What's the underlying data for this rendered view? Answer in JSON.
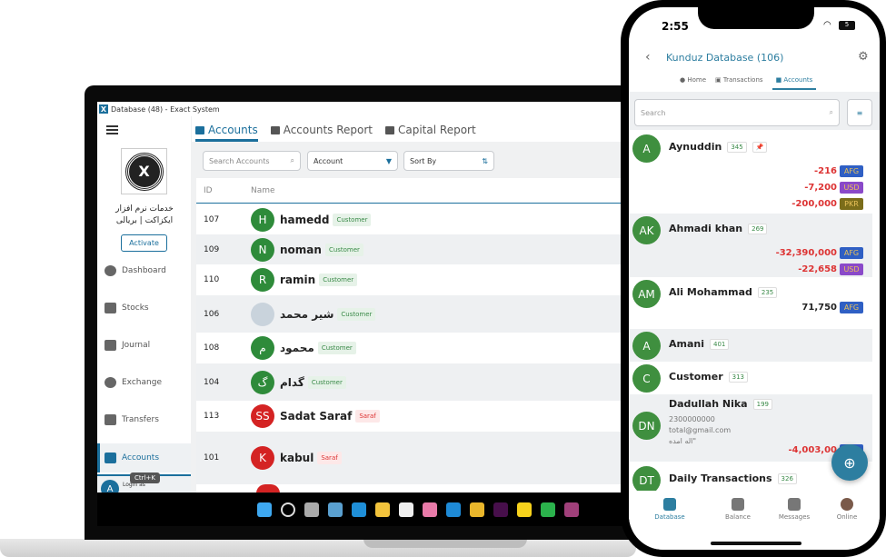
{
  "desktop": {
    "window_title": "Database (48) - Exact System",
    "company_name": "خدمات نرم افزار ایکزاکت | بریالی",
    "activate_label": "Activate",
    "sidebar": [
      {
        "label": "Dashboard"
      },
      {
        "label": "Stocks"
      },
      {
        "label": "Journal"
      },
      {
        "label": "Exchange"
      },
      {
        "label": "Transfers"
      },
      {
        "label": "Accounts",
        "active": true
      }
    ],
    "tooltip": "Ctrl+K",
    "login_label": "Login as",
    "login_avatar": "A",
    "tabs": [
      {
        "label": "Accounts",
        "active": true
      },
      {
        "label": "Accounts Report"
      },
      {
        "label": "Capital Report"
      }
    ],
    "search_placeholder": "Search Accounts",
    "account_filter": "Account",
    "sort_label": "Sort By",
    "columns": [
      "ID",
      "Name"
    ],
    "rows": [
      {
        "id": "107",
        "initials": "H",
        "name": "hamedd",
        "type": "Customer",
        "color": "#2e8b3a"
      },
      {
        "id": "109",
        "initials": "N",
        "name": "noman",
        "type": "Customer",
        "color": "#2e8b3a"
      },
      {
        "id": "110",
        "initials": "R",
        "name": "ramin",
        "type": "Customer",
        "color": "#2e8b3a"
      },
      {
        "id": "106",
        "initials": "",
        "name": "شیر محمد",
        "type": "Customer",
        "color": "#c9d3dc"
      },
      {
        "id": "108",
        "initials": "م",
        "name": "محمود",
        "type": "Customer",
        "color": "#2e8b3a"
      },
      {
        "id": "104",
        "initials": "گ",
        "name": "گدام",
        "type": "Customer",
        "color": "#2e8b3a"
      },
      {
        "id": "113",
        "initials": "SS",
        "name": "Sadat Saraf",
        "type": "Saraf",
        "color": "#d42323"
      },
      {
        "id": "101",
        "initials": "K",
        "name": "kabul",
        "type": "Saraf",
        "color": "#d42323"
      }
    ],
    "taskbar_icons": [
      "windows",
      "search",
      "task-view",
      "widgets",
      "edge",
      "file-explorer",
      "store",
      "photos",
      "vscode",
      "chrome",
      "xd",
      "sticky-notes",
      "app",
      "winrar"
    ]
  },
  "phone": {
    "time": "2:55",
    "battery": "5",
    "title": "Kunduz Database (106)",
    "tabs": [
      {
        "label": "Home"
      },
      {
        "label": "Transactions"
      },
      {
        "label": "Accounts",
        "active": true
      }
    ],
    "search_placeholder": "Search",
    "accounts": [
      {
        "initials": "A",
        "name": "Aynuddin",
        "count": "345",
        "pinned": true,
        "balances": [
          {
            "amount": "-216",
            "currency": "AFG"
          },
          {
            "amount": "-7,200",
            "currency": "USD"
          },
          {
            "amount": "-200,000",
            "currency": "PKR"
          }
        ]
      },
      {
        "initials": "AK",
        "name": "Ahmadi khan",
        "count": "269",
        "balances": [
          {
            "amount": "-32,390,000",
            "currency": "AFG"
          },
          {
            "amount": "-22,658",
            "currency": "USD"
          }
        ]
      },
      {
        "initials": "AM",
        "name": "Ali Mohammad",
        "count": "235",
        "balances": [
          {
            "amount": "71,750",
            "currency": "AFG"
          }
        ]
      },
      {
        "initials": "A",
        "name": "Amani",
        "count": "401",
        "balances": []
      },
      {
        "initials": "C",
        "name": "Customer",
        "count": "313",
        "balances": []
      },
      {
        "initials": "DN",
        "name": "Dadullah Nika",
        "count": "199",
        "phone": "2300000000",
        "email": "total@gmail.com",
        "note": "اله امده\"",
        "balances": [
          {
            "amount": "-4,003,00",
            "currency": "AFG"
          }
        ]
      },
      {
        "initials": "DT",
        "name": "Daily Transactions",
        "count": "326",
        "balances": []
      }
    ],
    "bottom_nav": [
      {
        "label": "Database",
        "active": true
      },
      {
        "label": "Balance"
      },
      {
        "label": "Messages"
      },
      {
        "label": "Online"
      }
    ],
    "accent": "#2d7ea0"
  }
}
